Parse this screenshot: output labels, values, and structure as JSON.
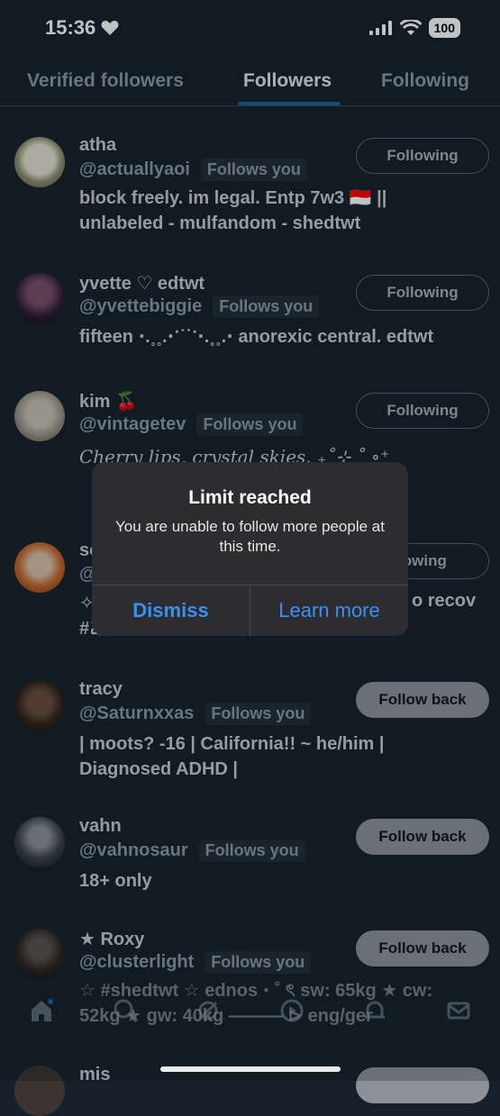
{
  "status": {
    "time": "15:36",
    "battery": "100"
  },
  "tabs": [
    {
      "label": "Verified followers"
    },
    {
      "label": "Followers"
    },
    {
      "label": "Following"
    }
  ],
  "followers": [
    {
      "name": "atha",
      "handle": "@actuallyaoi",
      "badge": "Follows you",
      "button": "Following",
      "bio_lines": [
        "block freely. im legal. Entp 7w3 🇮🇩 ||",
        "unlabeled - mulfandom - shedtwt"
      ]
    },
    {
      "name": "yvette ♡ edtwt",
      "handle": "@yvettebiggie",
      "badge": "Follows you",
      "button": "Following",
      "bio_lines": [
        "fifteen ⋅.˳˳.⋅ॱ˙˙ॱ⋅.˳˳.⋅ anorexic central. edtwt"
      ]
    },
    {
      "name": "kim 🍒",
      "handle": "@vintagetev",
      "badge": "Follows you",
      "button": "Following",
      "bio_lines": [
        "Cherry lips, crystal skies. ₊˚⊹ ˚ ∘⁺"
      ]
    },
    {
      "name": "so",
      "handle": "@",
      "badge": "",
      "button": "lowing",
      "bio_lines": [
        "✧",
        "#あ"
      ],
      "bio_right": "o recov"
    },
    {
      "name": "tracy",
      "handle": "@Saturnxxas",
      "badge": "Follows you",
      "button": "Follow back",
      "bio_lines": [
        "| moots? -16 | California!! ~ he/him |",
        "Diagnosed ADHD |"
      ]
    },
    {
      "name": "vahn",
      "handle": "@vahnosaur",
      "badge": "Follows you",
      "button": "Follow back",
      "bio_lines": [
        "18+ only"
      ]
    },
    {
      "name": "★ Roxy",
      "handle": "@clusterlight",
      "badge": "Follows you",
      "button": "Follow back",
      "bio_lines": [
        "☆ #shedtwt ☆ ednos ⋅ ˚ ৎ sw: 65kg ★ cw:",
        "52kg ★ gw: 40kg ——— ⊳ eng/ger"
      ]
    },
    {
      "name": "mis",
      "handle": "",
      "badge": "",
      "button": "",
      "bio_lines": []
    }
  ],
  "alert": {
    "title": "Limit reached",
    "message": "You are unable to follow more people at this time.",
    "dismiss": "Dismiss",
    "learn_more": "Learn more"
  },
  "nav": [
    "home-icon",
    "search-icon",
    "grok-icon",
    "spaces-icon",
    "notifications-icon",
    "messages-icon"
  ]
}
